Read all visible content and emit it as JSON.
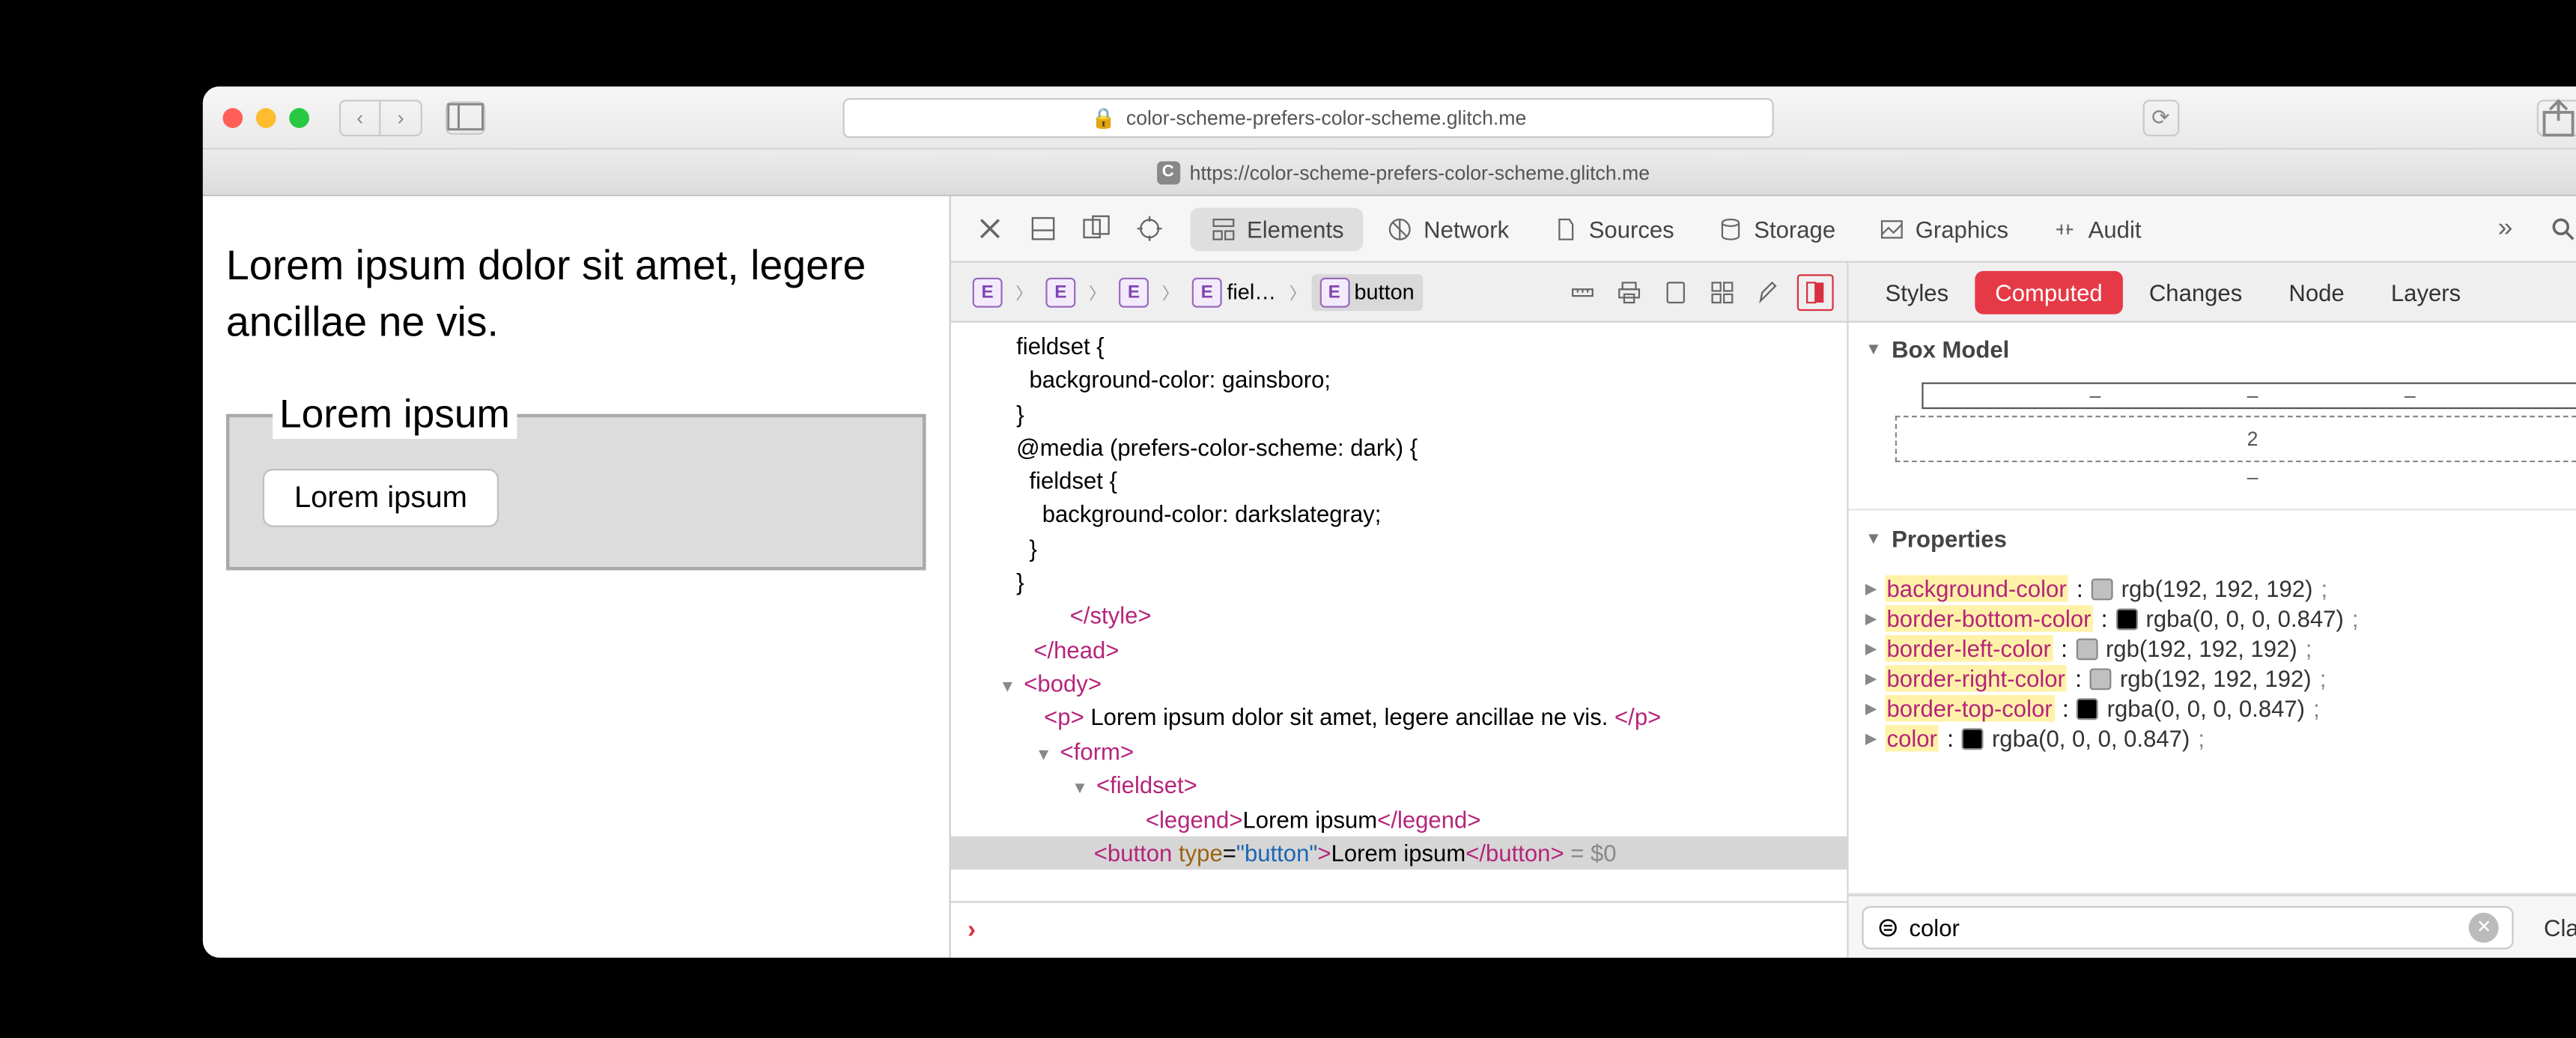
{
  "titlebar": {
    "url_display": "color-scheme-prefers-color-scheme.glitch.me",
    "lock_icon": "lock-icon"
  },
  "tabbar": {
    "tab_url": "https://color-scheme-prefers-color-scheme.glitch.me",
    "favicon_letter": "C"
  },
  "page": {
    "paragraph": "Lorem ipsum dolor sit amet, legere ancillae ne vis.",
    "legend": "Lorem ipsum",
    "button": "Lorem ipsum"
  },
  "devtools": {
    "tabs": [
      "Elements",
      "Network",
      "Sources",
      "Storage",
      "Graphics",
      "Audit"
    ],
    "active_tab": "Elements",
    "breadcrumbs": [
      "",
      "",
      "",
      "fiel…",
      "button"
    ],
    "dom_lines": {
      "l1": "      fieldset {",
      "l2": "        background-color: gainsboro;",
      "l3": "      }",
      "l4": "      @media (prefers-color-scheme: dark) {",
      "l5": "        fieldset {",
      "l6": "          background-color: darkslategray;",
      "l7": "        }",
      "l8": "      }",
      "style_close": "</style>",
      "head_close": "</head>",
      "body_open": "<body>",
      "p_text": " Lorem ipsum dolor sit amet, legere ancillae ne vis. ",
      "form_open": "<form>",
      "fieldset_open": "<fieldset>",
      "legend_open": "<legend>",
      "legend_text": "Lorem ipsum",
      "legend_close": "</legend>",
      "button_open_tag": "<button",
      "button_attr_name": "type",
      "button_attr_val": "\"button\"",
      "button_text": "Lorem ipsum",
      "button_close": "</button>",
      "eq0": " = $0"
    },
    "side": {
      "tabs": [
        "Styles",
        "Computed",
        "Changes",
        "Node",
        "Layers"
      ],
      "active": "Computed",
      "boxmodel_title": "Box Model",
      "boxmodel_value": "2",
      "properties_title": "Properties",
      "props": [
        {
          "name": "background-color",
          "swatch": "#c0c0c0",
          "value": "rgb(192, 192, 192)"
        },
        {
          "name": "border-bottom-color",
          "swatch": "#000000",
          "value": "rgba(0, 0, 0, 0.847)"
        },
        {
          "name": "border-left-color",
          "swatch": "#c0c0c0",
          "value": "rgb(192, 192, 192)"
        },
        {
          "name": "border-right-color",
          "swatch": "#c0c0c0",
          "value": "rgb(192, 192, 192)"
        },
        {
          "name": "border-top-color",
          "swatch": "#000000",
          "value": "rgba(0, 0, 0, 0.847)"
        },
        {
          "name": "color",
          "swatch": "#000000",
          "value": "rgba(0, 0, 0, 0.847)"
        }
      ],
      "filter_value": "color",
      "classes_btn": "Classes"
    }
  }
}
